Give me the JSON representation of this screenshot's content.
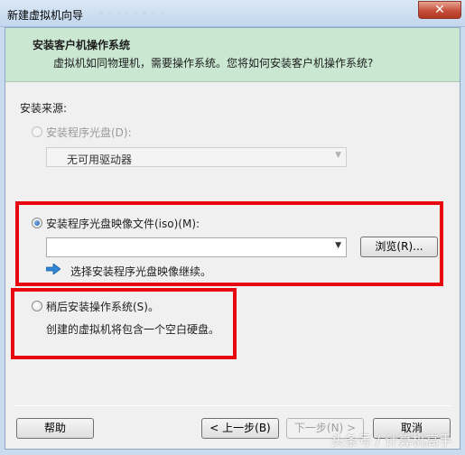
{
  "window": {
    "title": "新建虚拟机向导",
    "close_label": "✕"
  },
  "header": {
    "title": "安装客户机操作系统",
    "subtitle": "虚拟机如同物理机，需要操作系统。您将如何安装客户机操作系统?"
  },
  "source": {
    "label": "安装来源:",
    "disc_option": {
      "label": "安装程序光盘(D):",
      "selected": false,
      "enabled": false,
      "drive_value": "无可用驱动器"
    },
    "iso_option": {
      "label": "安装程序光盘映像文件(iso)(M):",
      "selected": true,
      "path_value": "",
      "browse_label": "浏览(R)...",
      "hint": "选择安装程序光盘映像继续。"
    },
    "later_option": {
      "label": "稍后安装操作系统(S)。",
      "selected": false,
      "description": "创建的虚拟机将包含一个空白硬盘。"
    }
  },
  "footer": {
    "help_label": "帮助",
    "back_label": "< 上一步(B)",
    "next_label": "下一步(N) >",
    "cancel_label": "取消"
  },
  "watermark": "头条号 / 计算机高手",
  "colors": {
    "highlight_box": "#e8070f",
    "header_bg": "#c9e7d1",
    "radio_fill": "#1b58a8"
  }
}
